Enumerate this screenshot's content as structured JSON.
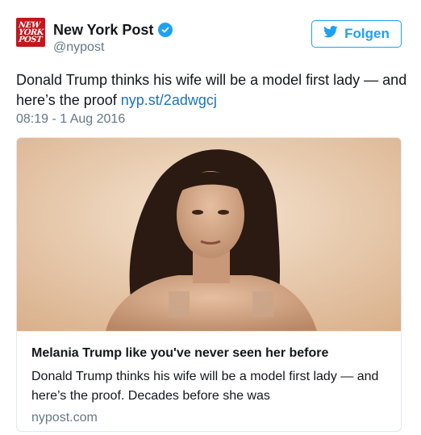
{
  "author": {
    "name": "New York Post",
    "handle": "@nypost",
    "avatar_lines": [
      "NEW",
      "YORK",
      "POST"
    ],
    "brand_color": "#c4161c",
    "verified_icon": "verified-badge-icon"
  },
  "follow_button": {
    "label": "Folgen",
    "icon": "twitter-bird-icon",
    "color": "#1da1f2"
  },
  "tweet": {
    "text": "Donald Trump thinks his wife will be a model first lady — and here’s the proof",
    "link": "nyp.st/2adwgcj",
    "timestamp": "08:19 - 1 Aug 2016"
  },
  "card": {
    "title": "Melania Trump like you've never seen her before",
    "description": "Donald Trump thinks his wife will be a model first lady — and here’s the proof. Decades before she was",
    "domain": "nypost.com"
  }
}
